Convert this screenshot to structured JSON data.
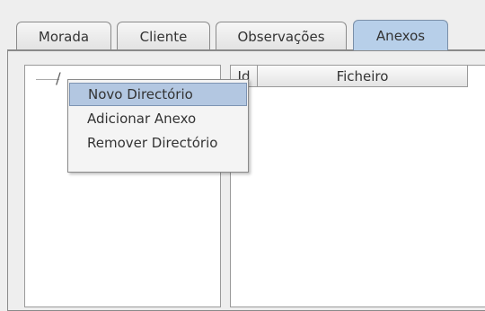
{
  "tabs": [
    {
      "label": "Morada",
      "active": false
    },
    {
      "label": "Cliente",
      "active": false
    },
    {
      "label": "Observações",
      "active": false
    },
    {
      "label": "Anexos",
      "active": true
    }
  ],
  "table": {
    "columns": [
      "Id",
      "Ficheiro"
    ]
  },
  "context_menu": {
    "items": [
      {
        "label": "Novo Directório",
        "selected": true
      },
      {
        "label": "Adicionar Anexo",
        "selected": false
      },
      {
        "label": "Remover Directório",
        "selected": false
      }
    ]
  },
  "icons": {
    "tree_node": "folder-icon"
  },
  "colors": {
    "selected_tab": "#b7cfe9",
    "menu_highlight": "#b3c7e1"
  }
}
